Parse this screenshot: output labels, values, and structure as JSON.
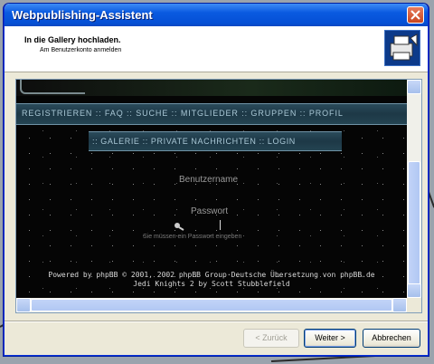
{
  "window": {
    "title": "Webpublishing-Assistent"
  },
  "header": {
    "title": "In die Gallery hochladen.",
    "subtitle": "Am Benutzerkonto anmelden"
  },
  "web": {
    "nav_main": "REGISTRIEREN :: FAQ :: SUCHE :: MITGLIEDER :: GRUPPEN :: PROFIL",
    "nav_secondary": ":: GALERIE :: PRIVATE NACHRICHTEN :: LOGIN",
    "username_label": "Benutzername",
    "password_label": "Passwort",
    "password_hint": "Sie müssen ein Passwort eingeben",
    "footer_line1": "Powered by phpBB © 2001, 2002 phpBB Group·Deutsche Übersetzung von phpBB.de",
    "footer_line2": "Jedi Knights 2 by Scott Stubblefield"
  },
  "buttons": {
    "back": "< Zurück",
    "next": "Weiter >",
    "cancel": "Abbrechen"
  },
  "icons": {
    "close": "close-icon",
    "wizard": "publish-wizard-icon",
    "key": "key-icon"
  },
  "colors": {
    "titlebar": "#0550d6",
    "nav_text": "#a9c8d6",
    "close_button": "#c9451f"
  }
}
